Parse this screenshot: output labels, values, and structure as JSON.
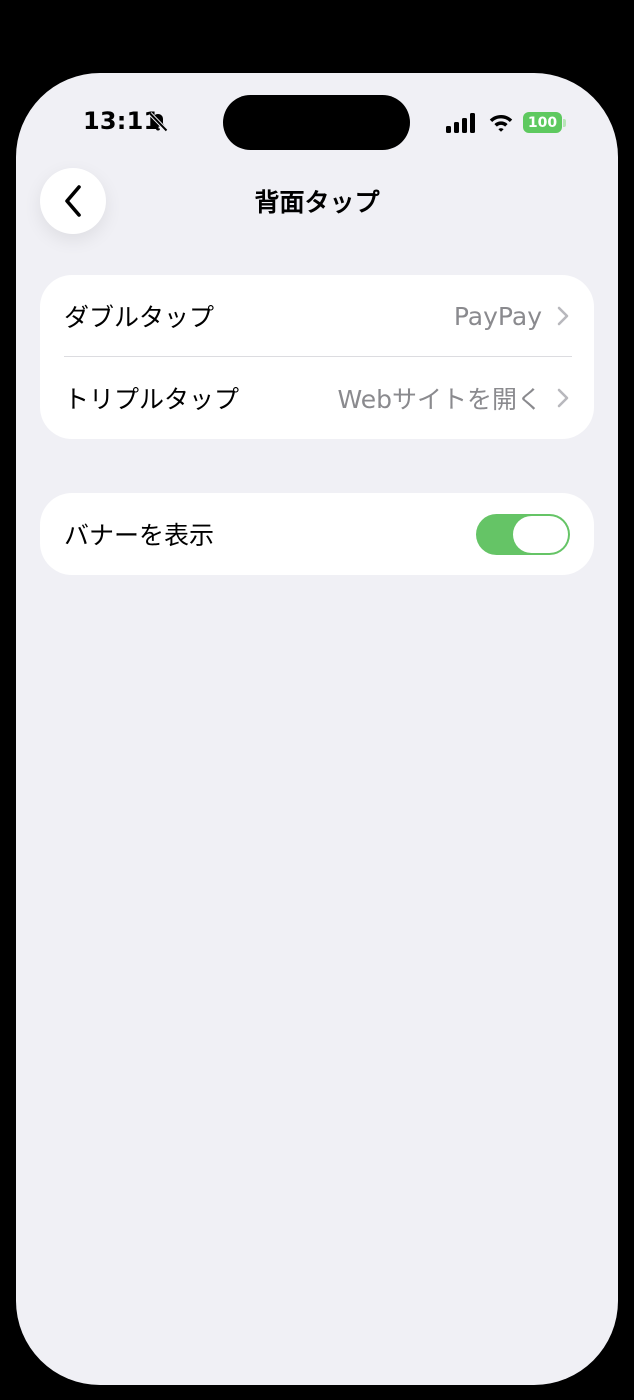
{
  "status_bar": {
    "time": "13:11",
    "battery": "100",
    "icons": [
      "bell-slash-icon",
      "cellular-signal-icon",
      "wifi-icon",
      "battery-icon"
    ],
    "battery_color": "#5ec95f"
  },
  "nav": {
    "title": "背面タップ",
    "back_icon": "chevron-left-icon"
  },
  "tap_group": {
    "items": [
      {
        "label": "ダブルタップ",
        "value": "PayPay"
      },
      {
        "label": "トリプルタップ",
        "value": "Webサイトを開く"
      }
    ]
  },
  "banner_group": {
    "label": "バナーを表示",
    "toggle_on": true,
    "toggle_color": "#65c466"
  }
}
